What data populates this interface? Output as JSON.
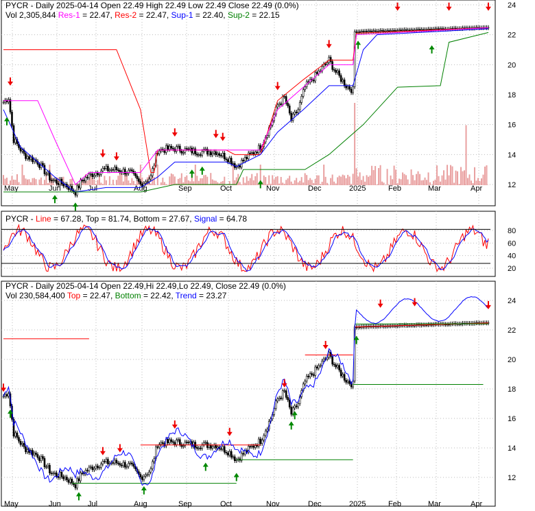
{
  "header1": {
    "line1": "PYCR - Daily 2025-04-14 Open 22.49  High 22.49  Low 22.49  Close 22.49 (0.0%)",
    "vol": "Vol 2,305,844",
    "res1": "Res-1",
    "res1v": " = 22.47, ",
    "res2": "Res-2",
    "res2v": " = 22.47, ",
    "sup1": "Sup-1",
    "sup1v": " = 22.40, ",
    "sup2": "Sup-2",
    "sup2v": " = 22.15"
  },
  "header2": {
    "prefix": "PYCR - ",
    "line": "Line",
    "linev": " = 67.28, Top = 81.74, Bottom = 27.67, ",
    "signal": "Signal",
    "signalv": " = 64.78"
  },
  "header3": {
    "line1": "PYCR - Daily 2025-04-14 Open 22.49,Hi 22.49,Lo 22.49, Close 22.49 (0.0%)",
    "vol": "Vol 230,584,400 ",
    "top": "Top",
    "topv": " = 22.47, ",
    "bottom": "Bottom",
    "bottomv": " = 22.42, ",
    "trend": "Trend",
    "trendv": " = 23.27"
  },
  "colors": {
    "res1": "#ff00ff",
    "res2": "#ff0000",
    "sup1": "#0000ff",
    "sup2": "#008000"
  },
  "chart_data": {
    "type": "candlestick",
    "months": [
      "May",
      "Jun",
      "Jul",
      "Aug",
      "Sep",
      "Oct",
      "Nov",
      "Dec",
      "2025",
      "Feb",
      "Mar",
      "Apr"
    ],
    "price_ticks": [
      "24",
      "22",
      "20",
      "18",
      "16",
      "14",
      "12"
    ],
    "osc_ticks": [
      "80",
      "60",
      "40",
      "20"
    ],
    "close_path": [
      [
        0,
        17.5
      ],
      [
        3,
        17.8
      ],
      [
        6,
        15
      ],
      [
        12,
        14
      ],
      [
        20,
        13.5
      ],
      [
        28,
        12.3
      ],
      [
        36,
        12
      ],
      [
        42,
        11.5
      ],
      [
        46,
        12.3
      ],
      [
        52,
        12.7
      ],
      [
        58,
        13
      ],
      [
        66,
        13
      ],
      [
        74,
        12.8
      ],
      [
        80,
        12.0
      ],
      [
        86,
        12.5
      ],
      [
        90,
        14.3
      ],
      [
        100,
        14.4
      ],
      [
        112,
        14.2
      ],
      [
        124,
        14.2
      ],
      [
        132,
        13.7
      ],
      [
        136,
        13.2
      ],
      [
        142,
        13.8
      ],
      [
        150,
        14.5
      ],
      [
        156,
        16
      ],
      [
        160,
        17.3
      ],
      [
        164,
        17.8
      ],
      [
        168,
        16.3
      ],
      [
        172,
        17
      ],
      [
        176,
        18.5
      ],
      [
        184,
        19.5
      ],
      [
        190,
        20.3
      ],
      [
        194,
        19.5
      ],
      [
        200,
        18.6
      ],
      [
        204,
        18.3
      ],
      [
        205,
        22.2
      ],
      [
        230,
        22.3
      ],
      [
        260,
        22.4
      ],
      [
        283,
        22.49
      ]
    ],
    "last_close": 22.49,
    "volume_note": "large spike at start of 2025"
  }
}
